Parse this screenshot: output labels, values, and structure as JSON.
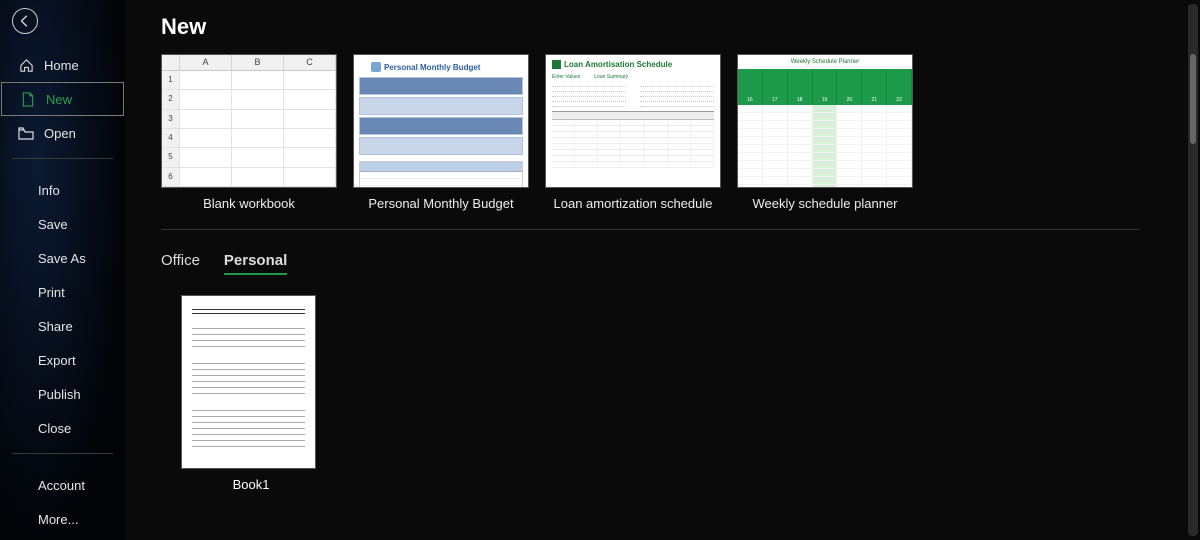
{
  "page_title": "New",
  "sidebar": {
    "home": "Home",
    "new": "New",
    "open": "Open",
    "info": "Info",
    "save": "Save",
    "save_as": "Save As",
    "print": "Print",
    "share": "Share",
    "export": "Export",
    "publish": "Publish",
    "close": "Close",
    "account": "Account",
    "more": "More..."
  },
  "templates": [
    {
      "label": "Blank workbook"
    },
    {
      "label": "Personal Monthly Budget"
    },
    {
      "label": "Loan amortization schedule"
    },
    {
      "label": "Weekly schedule planner"
    }
  ],
  "thumb_blank": {
    "cols": [
      "A",
      "B",
      "C"
    ],
    "rows": [
      "1",
      "2",
      "3",
      "4",
      "5",
      "6"
    ]
  },
  "thumb_budget": {
    "title": "Personal Monthly Budget"
  },
  "thumb_loan": {
    "title": "Loan Amortisation Schedule",
    "left_head": "Enter Values",
    "right_head": "Loan Summary"
  },
  "thumb_planner": {
    "title": "Weekly Schedule Planner",
    "days": [
      "16",
      "17",
      "18",
      "19",
      "20",
      "21",
      "22"
    ]
  },
  "tabs": {
    "office": "Office",
    "personal": "Personal"
  },
  "personal_templates": [
    {
      "label": "Book1"
    }
  ]
}
